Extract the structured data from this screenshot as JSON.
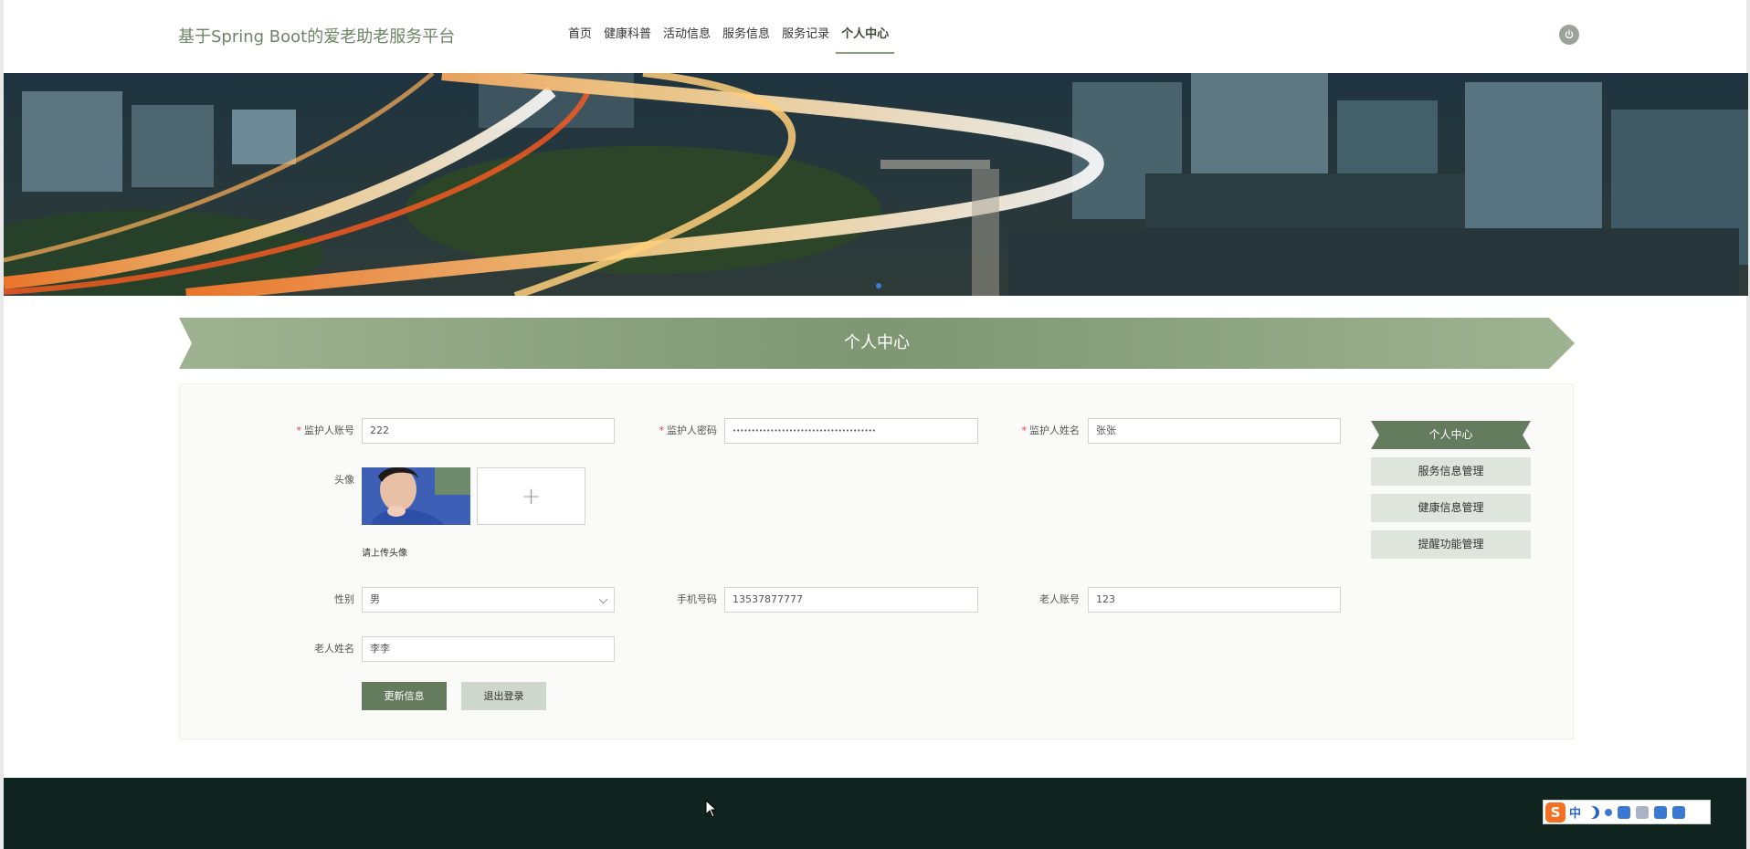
{
  "header": {
    "site_title": "基于Spring Boot的爱老助老服务平台",
    "nav": [
      {
        "label": "首页",
        "active": false
      },
      {
        "label": "健康科普",
        "active": false
      },
      {
        "label": "活动信息",
        "active": false
      },
      {
        "label": "服务信息",
        "active": false
      },
      {
        "label": "服务记录",
        "active": false
      },
      {
        "label": "个人中心",
        "active": true
      }
    ],
    "power_icon": "power-icon"
  },
  "section": {
    "title": "个人中心"
  },
  "form": {
    "account": {
      "label": "监护人账号",
      "required": true,
      "value": "222"
    },
    "password": {
      "label": "监护人密码",
      "required": true,
      "value": "••••••••••••••••••••••••••••••••••••••"
    },
    "name": {
      "label": "监护人姓名",
      "required": true,
      "value": "张张"
    },
    "avatar": {
      "label": "头像",
      "hint": "请上传头像",
      "plus": "+"
    },
    "gender": {
      "label": "性别",
      "value": "男"
    },
    "phone": {
      "label": "手机号码",
      "value": "13537877777"
    },
    "elder_account": {
      "label": "老人账号",
      "value": "123"
    },
    "elder_name": {
      "label": "老人姓名",
      "value": "李李"
    },
    "update_button": "更新信息",
    "logout_button": "退出登录"
  },
  "side_menu": [
    {
      "label": "个人中心",
      "active": true
    },
    {
      "label": "服务信息管理",
      "active": false
    },
    {
      "label": "健康信息管理",
      "active": false
    },
    {
      "label": "提醒功能管理",
      "active": false
    }
  ],
  "ime": {
    "logo": "S",
    "mode": "中"
  },
  "colors": {
    "brand_green": "#647b5e",
    "ribbon_green": "#8aa079",
    "footer": "#0f241f",
    "required": "#e4393c"
  }
}
